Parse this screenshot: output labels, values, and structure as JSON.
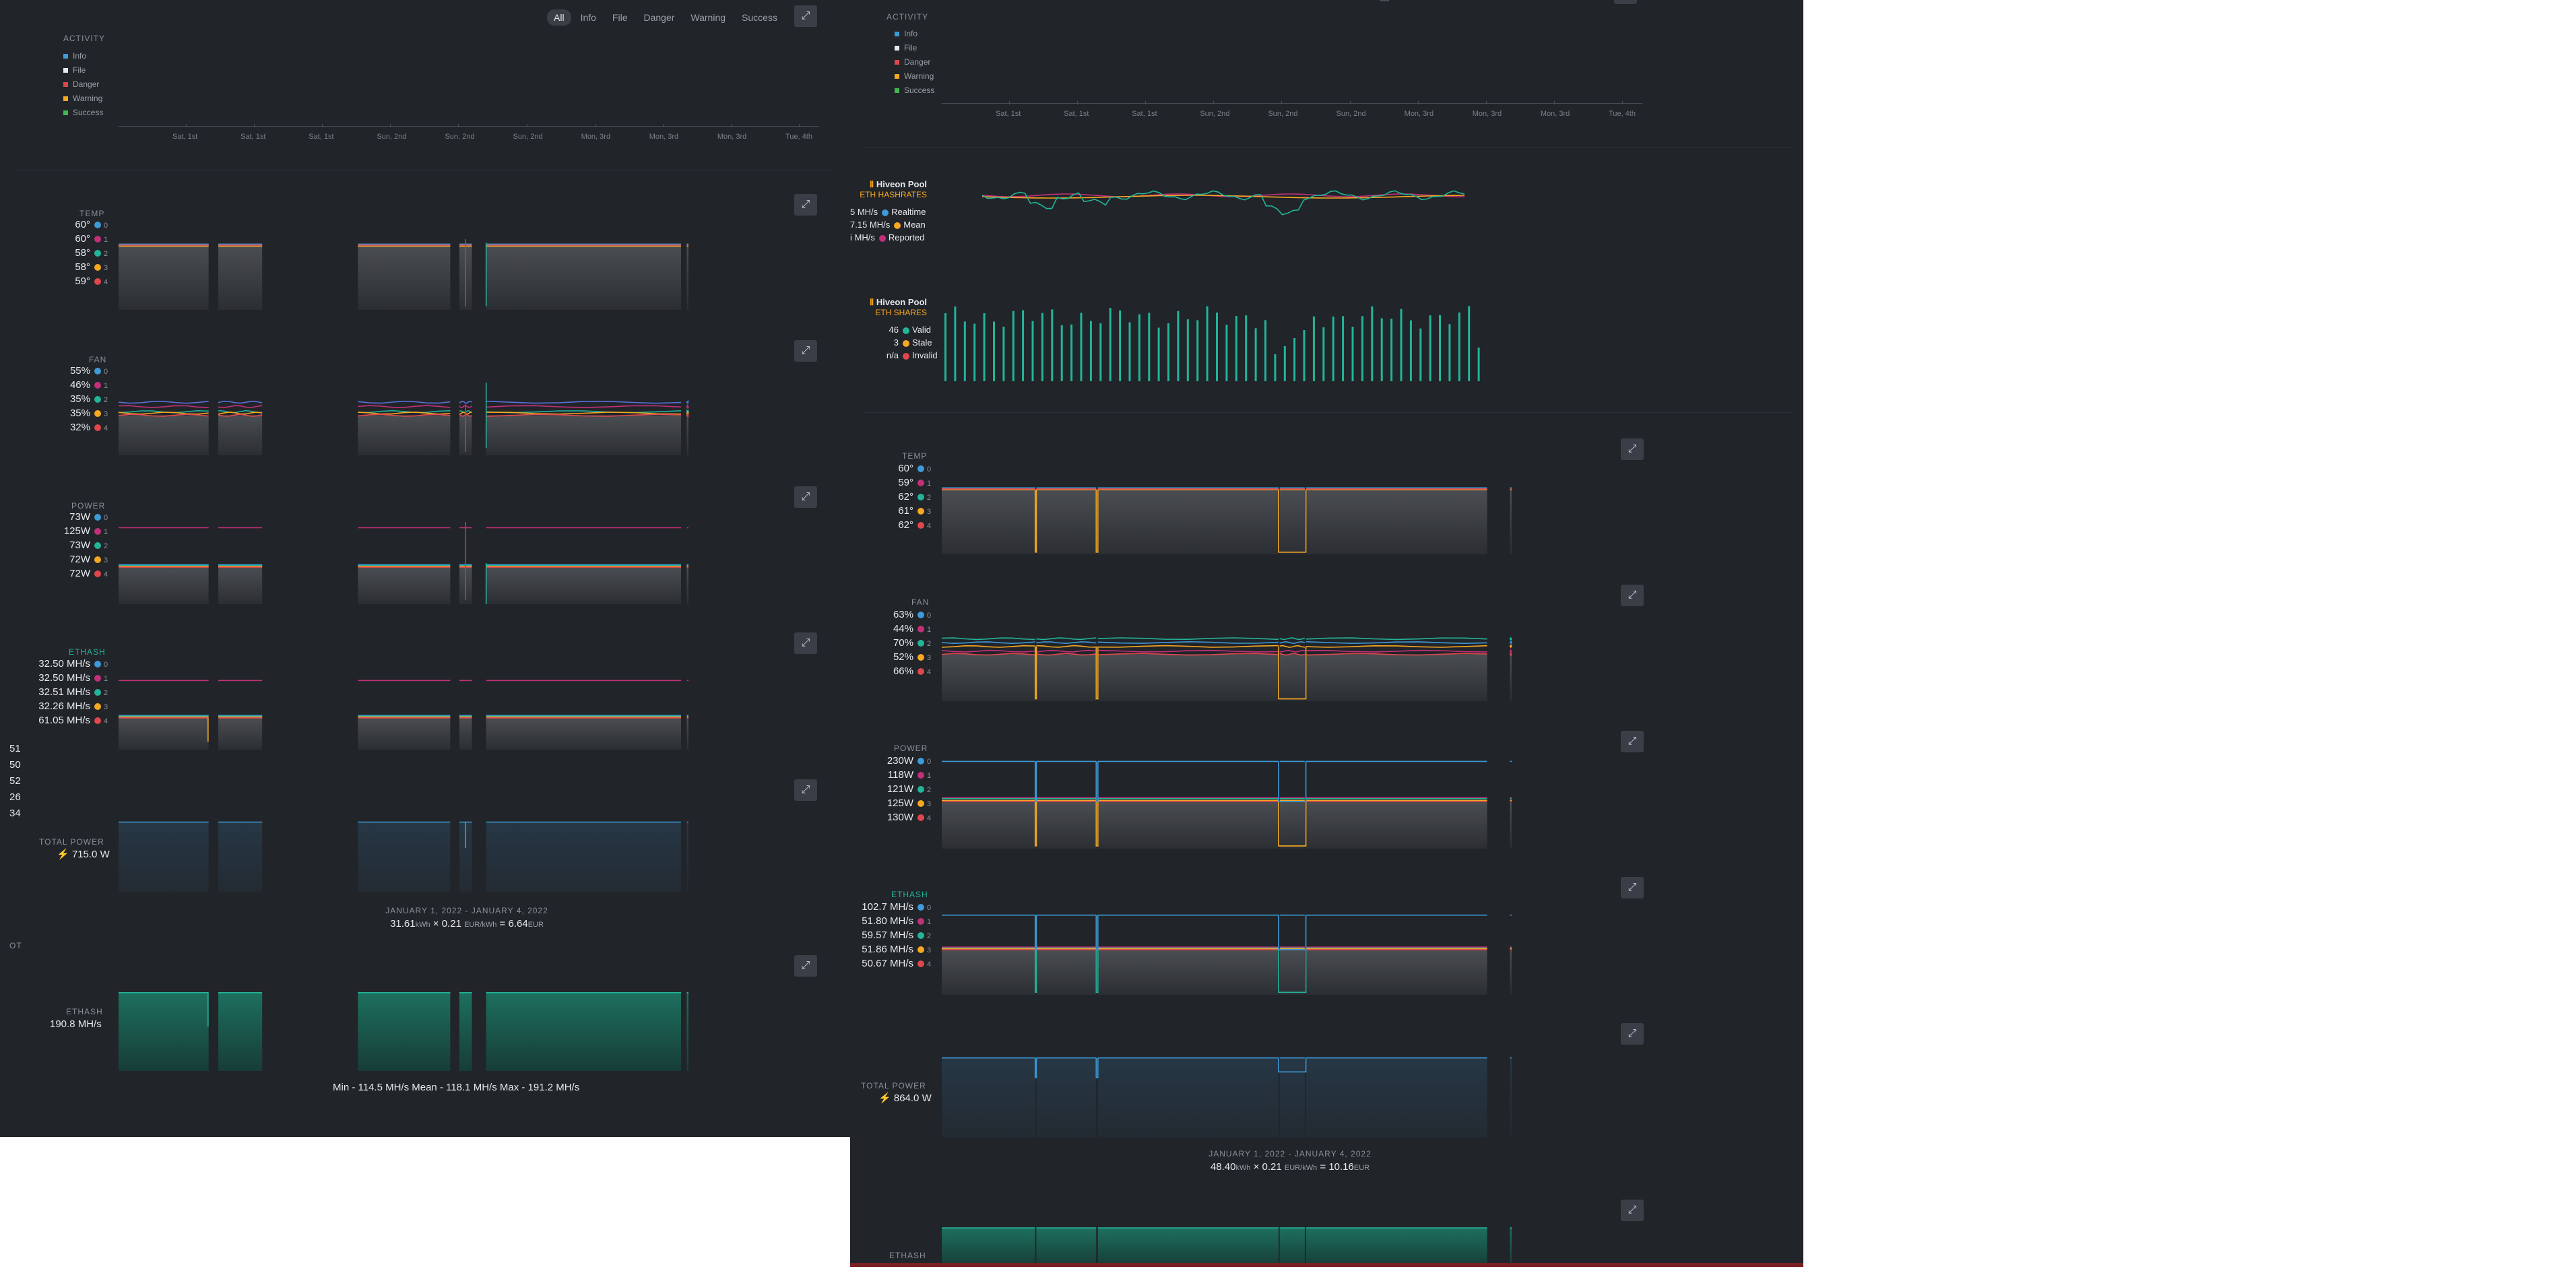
{
  "filters": [
    "All",
    "Info",
    "File",
    "Danger",
    "Warning",
    "Success"
  ],
  "activity": {
    "label": "ACTIVITY",
    "legend": [
      {
        "name": "Info",
        "color": "#3d9bd8"
      },
      {
        "name": "File",
        "color": "#e6e9ee"
      },
      {
        "name": "Danger",
        "color": "#e0474c"
      },
      {
        "name": "Warning",
        "color": "#f6a821"
      },
      {
        "name": "Success",
        "color": "#3fb950"
      }
    ],
    "ticks": [
      "Sat, 1st",
      "Sat, 1st",
      "Sat, 1st",
      "Sun, 2nd",
      "Sun, 2nd",
      "Sun, 2nd",
      "Mon, 3rd",
      "Mon, 3rd",
      "Mon, 3rd",
      "Tue, 4th"
    ]
  },
  "gpu_colors": [
    "#3d9bd8",
    "#c2307a",
    "#22b59a",
    "#f6a821",
    "#e0474c"
  ],
  "left": {
    "temp": {
      "label": "TEMP",
      "values": [
        "60°",
        "60°",
        "58°",
        "58°",
        "59°"
      ]
    },
    "fan": {
      "label": "FAN",
      "values": [
        "55%",
        "46%",
        "35%",
        "35%",
        "32%"
      ]
    },
    "power": {
      "label": "POWER",
      "values": [
        "73W",
        "125W",
        "73W",
        "72W",
        "72W"
      ]
    },
    "ethash": {
      "label": "ETHASH",
      "values": [
        "32.50 MH/s",
        "32.50 MH/s",
        "32.51 MH/s",
        "32.26 MH/s",
        "61.05 MH/s"
      ]
    },
    "cut_numbers": [
      "51",
      "50",
      "52",
      "26",
      "34"
    ],
    "total_power": {
      "label": "TOTAL POWER",
      "value": "715.0 W"
    },
    "period": "JANUARY 1, 2022 - JANUARY 4, 2022",
    "calc": {
      "kwh": "31.61",
      "kwh_unit": "kWh",
      "rate": "0.21",
      "rate_unit": "EUR/kWh",
      "result": "6.64",
      "result_unit": "EUR"
    },
    "cut_label": "OT",
    "ethash_total": {
      "label": "ETHASH",
      "value": "190.8 MH/s"
    },
    "stats": "Min - 114.5 MH/s   Mean - 118.1 MH/s   Max - 191.2 MH/s"
  },
  "right": {
    "hashrates": {
      "pool": "Hiveon Pool",
      "sub": "ETH HASHRATES",
      "rows": [
        {
          "value": "5 MH/s",
          "name": "Realtime",
          "color": "#3d9bd8"
        },
        {
          "value": "7.15 MH/s",
          "name": "Mean",
          "color": "#f6a821"
        },
        {
          "value": "i MH/s",
          "name": "Reported",
          "color": "#c2307a"
        }
      ]
    },
    "shares": {
      "pool": "Hiveon Pool",
      "sub": "ETH SHARES",
      "rows": [
        {
          "value": "46",
          "name": "Valid",
          "color": "#22b59a"
        },
        {
          "value": "3",
          "name": "Stale",
          "color": "#f6a821"
        },
        {
          "value": "n/a",
          "name": "Invalid",
          "color": "#e0474c"
        }
      ]
    },
    "temp": {
      "label": "TEMP",
      "values": [
        "60°",
        "59°",
        "62°",
        "61°",
        "62°"
      ]
    },
    "fan": {
      "label": "FAN",
      "values": [
        "63%",
        "44%",
        "70%",
        "52%",
        "66%"
      ]
    },
    "power": {
      "label": "POWER",
      "values": [
        "230W",
        "118W",
        "121W",
        "125W",
        "130W"
      ]
    },
    "ethash": {
      "label": "ETHASH",
      "values": [
        "102.7 MH/s",
        "51.80 MH/s",
        "59.57 MH/s",
        "51.86 MH/s",
        "50.67 MH/s"
      ]
    },
    "total_power": {
      "label": "TOTAL POWER",
      "value": "864.0 W"
    },
    "period": "JANUARY 1, 2022 - JANUARY 4, 2022",
    "calc": {
      "kwh": "48.40",
      "kwh_unit": "kWh",
      "rate": "0.21",
      "rate_unit": "EUR/kWh",
      "result": "10.16",
      "result_unit": "EUR"
    },
    "ethash_total": {
      "label": "ETHASH"
    }
  },
  "gpu_indices": [
    "0",
    "1",
    "2",
    "3",
    "4"
  ]
}
